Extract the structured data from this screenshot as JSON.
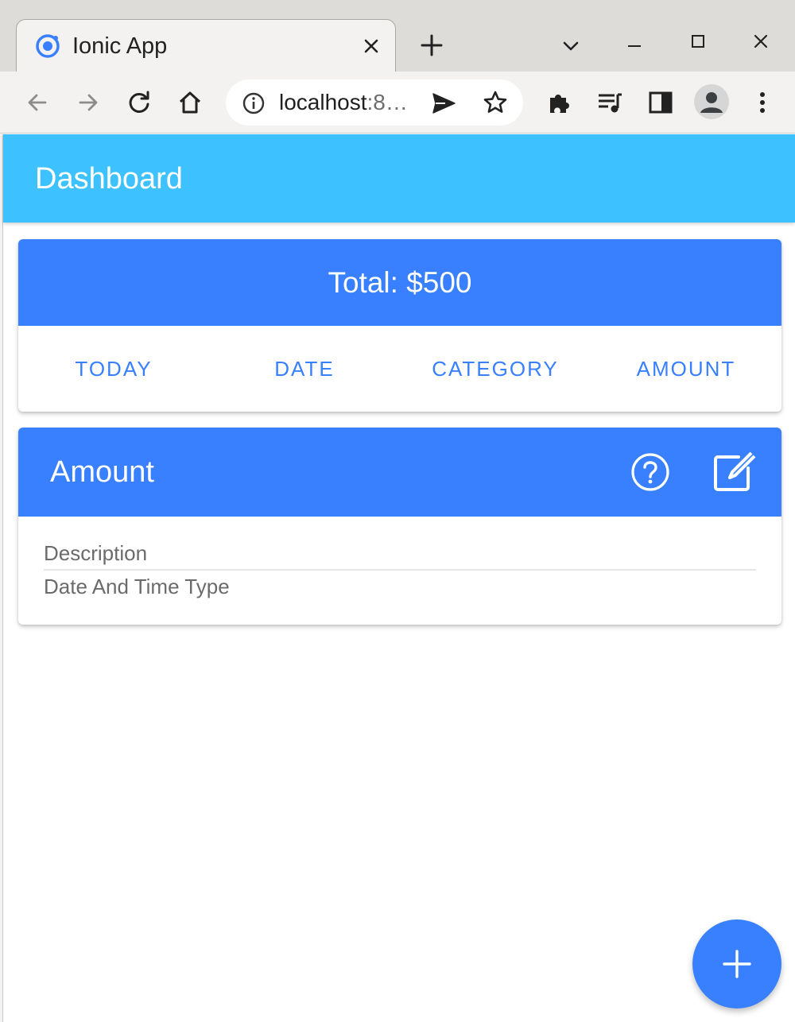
{
  "browser": {
    "tab_title": "Ionic App",
    "url_host": "localhost",
    "url_rest": ":8…",
    "icons": [
      "ionic-favicon-icon",
      "close-icon",
      "plus-icon",
      "chevron-down-icon",
      "minimize-icon",
      "maximize-icon",
      "window-close-icon",
      "back-arrow-icon",
      "forward-arrow-icon",
      "reload-icon",
      "home-icon",
      "info-icon",
      "send-icon",
      "star-icon",
      "extensions-puzzle-icon",
      "media-queue-icon",
      "side-panel-icon",
      "profile-icon",
      "kebab-menu-icon"
    ]
  },
  "colors": {
    "header": "#3dc2ff",
    "primary": "#3880ff",
    "text_muted": "#6b6b6b"
  },
  "header": {
    "title": "Dashboard"
  },
  "total_card": {
    "title": "Total: $500",
    "segments": [
      "TODAY",
      "DATE",
      "CATEGORY",
      "AMOUNT"
    ]
  },
  "amount_card": {
    "title": "Amount",
    "icons": [
      "help-circle-icon",
      "create-icon"
    ],
    "description": "Description",
    "type": "Date And Time Type"
  },
  "fab": {
    "icon": "add-icon"
  }
}
